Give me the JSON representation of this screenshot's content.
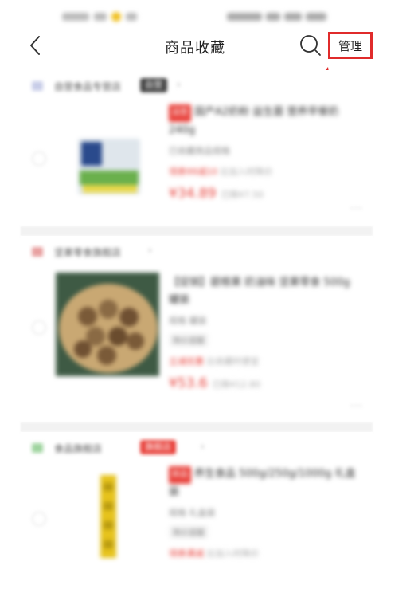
{
  "status_bar": {
    "left_text": "10:00",
    "right_text": "5G"
  },
  "nav": {
    "title": "商品收藏",
    "manage_label": "管理"
  },
  "colors": {
    "highlight": "#e02b2b",
    "price": "#e8403a",
    "separator": "#f2f2f2"
  },
  "icons": {
    "back": "chevron-left-icon",
    "search": "search-icon",
    "more": "more-icon",
    "arrow": "arrow-annotation-icon"
  },
  "products": [
    {
      "store_name": "自营食品专营店",
      "store_badge": "自营",
      "tag": "自营",
      "title": "国产A2奶粉 益生菌 营养早餐奶 240g",
      "meta": "已收藏商品规格",
      "extra": "",
      "promo": "领券99减10",
      "promo_note": "比加入时降价",
      "price": "¥34.89",
      "price_note": "已降¥7.50"
    },
    {
      "store_name": "坚果零食旗舰店",
      "store_badge": "",
      "tag": "",
      "title": "【促销】碧根果 奶油味 坚果零食 500g 罐装",
      "meta": "规格 罐装",
      "extra": "降价提醒",
      "promo": "立减优惠",
      "promo_note": "比收藏时便宜",
      "price": "¥53.6",
      "price_note": "已降¥12.80"
    },
    {
      "store_name": "食品旗舰店",
      "store_badge": "旗舰店",
      "tag": "新品",
      "title": "养生食品 500g/250g/1000g 礼盒装",
      "meta": "规格 礼盒装",
      "extra": "降价提醒",
      "promo": "领券满减",
      "promo_note": "比加入时降价",
      "price": "",
      "price_note": ""
    }
  ]
}
